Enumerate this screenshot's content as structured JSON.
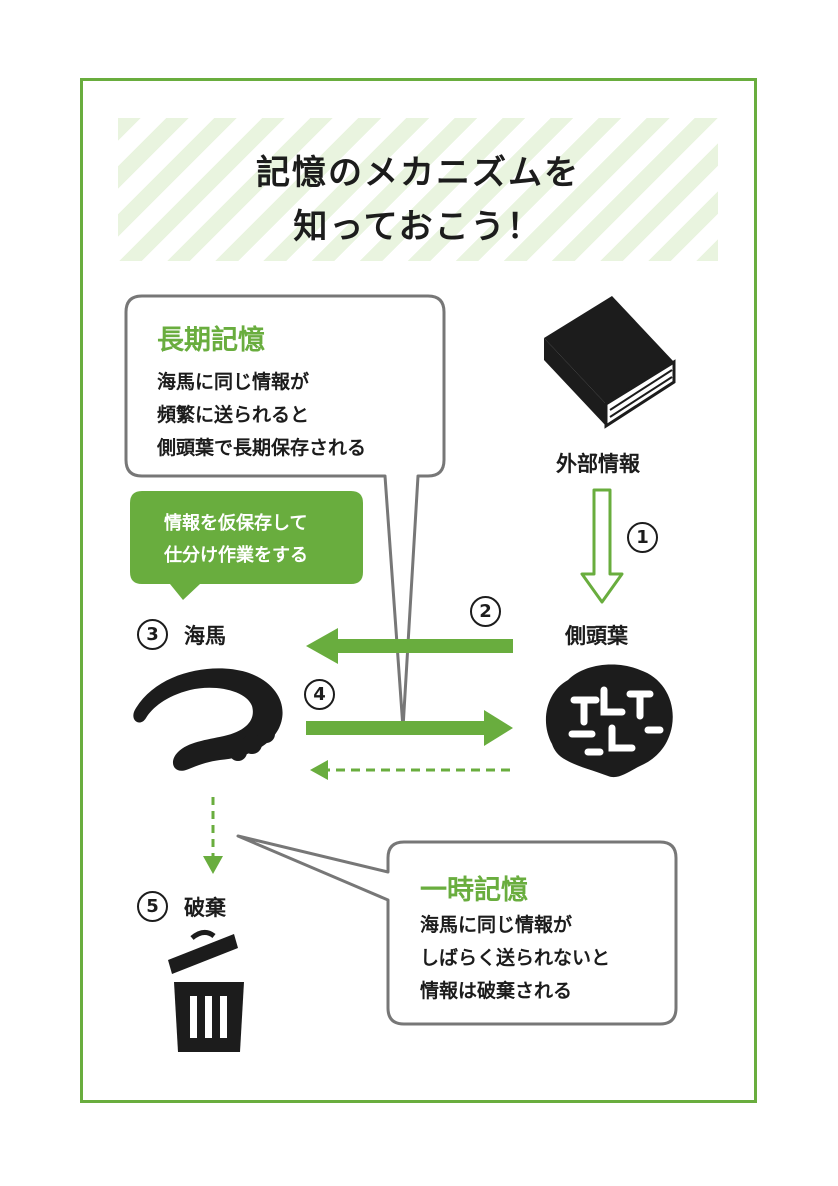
{
  "title": {
    "line1": "記憶のメカニズムを",
    "line2": "知っておこう！"
  },
  "long_term": {
    "heading": "長期記憶",
    "lines": [
      "海馬に同じ情報が",
      "頻繁に送られると",
      "側頭葉で長期保存される"
    ]
  },
  "hippocampus_note": {
    "lines": [
      "情報を仮保存して",
      "仕分け作業をする"
    ]
  },
  "temporary": {
    "heading": "一時記憶",
    "lines": [
      "海馬に同じ情報が",
      "しばらく送られないと",
      "情報は破棄される"
    ]
  },
  "labels": {
    "external_info": "外部情報",
    "temporal_lobe": "側頭葉",
    "hippocampus": "海馬",
    "discard": "破棄"
  },
  "steps": {
    "s1": "1",
    "s2": "2",
    "s3": "3",
    "s4": "4",
    "s5": "5"
  },
  "icons": {
    "book": "book-icon",
    "brain": "brain-icon",
    "hippocampus": "hippocampus-icon",
    "trash": "trash-can-icon"
  },
  "colors": {
    "accent": "#69ad3e",
    "dark": "#1c1c1c",
    "stripe": "#e9f4df",
    "bubble_border": "#777777"
  }
}
